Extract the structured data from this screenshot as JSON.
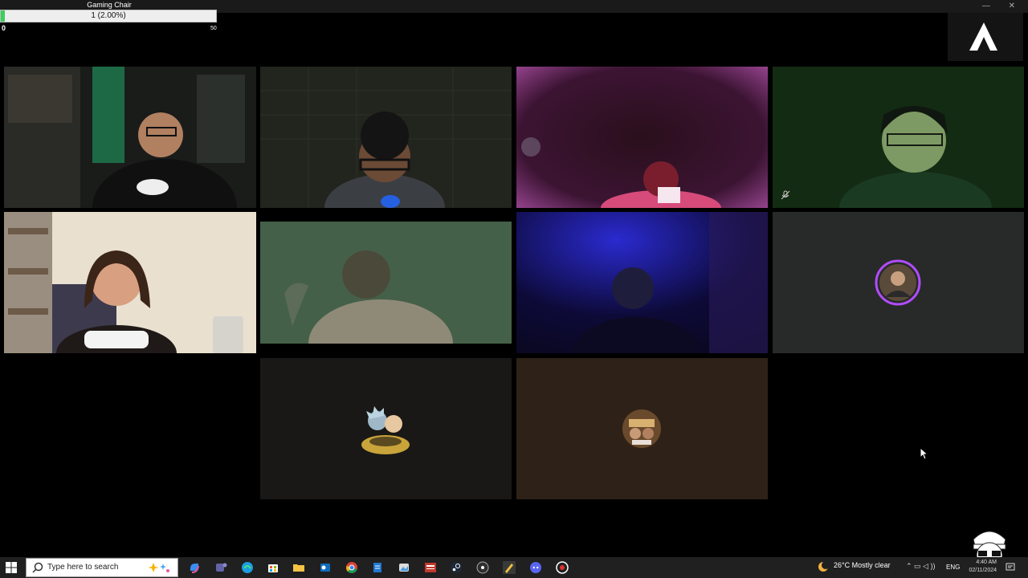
{
  "goal_widget": {
    "title": "Gaming Chair",
    "progress_text": "1 (2.00%)",
    "progress_fraction": 0.02,
    "min_label": "0",
    "max_label": "50"
  },
  "tiles": [
    {
      "name": "participant-1-video",
      "kind": "video",
      "scene": "streamer with cap in gaming room"
    },
    {
      "name": "participant-2-video",
      "kind": "video",
      "scene": "person with glasses, dark wall"
    },
    {
      "name": "participant-3-video",
      "kind": "video",
      "scene": "dark room with pink light"
    },
    {
      "name": "participant-4-video",
      "kind": "video",
      "scene": "person with glasses, green light",
      "muted": true
    },
    {
      "name": "participant-5-video",
      "kind": "video",
      "scene": "woman with microphone, bright room"
    },
    {
      "name": "participant-6-video",
      "kind": "video",
      "scene": "person in green-tinted room"
    },
    {
      "name": "participant-7-video",
      "kind": "video",
      "scene": "person in blue-lit room"
    },
    {
      "name": "participant-8-avatar",
      "kind": "avatar",
      "speaking": true
    },
    {
      "name": "participant-9-avatar",
      "kind": "avatar"
    },
    {
      "name": "participant-10-avatar",
      "kind": "avatar"
    }
  ],
  "colors": {
    "avatar_tile_dark": "#272a28",
    "avatar_tile_black": "#191816",
    "avatar_tile_brown": "#2e2118",
    "speaking_ring": "#b14cff",
    "goal_fill": "#3ccf5a"
  },
  "taskbar": {
    "search_placeholder": "Type here to search",
    "weather": "26°C  Mostly clear",
    "language": "ENG",
    "time": "4:40 AM",
    "date": "02/11/2024",
    "icons": [
      "start-icon",
      "copilot-icon",
      "teams-icon",
      "edge-icon",
      "store-icon",
      "file-explorer-icon",
      "outlook-icon",
      "chrome-icon",
      "notepad-icon",
      "photo-editor-icon",
      "news-icon",
      "steam-icon",
      "obs-icon",
      "pen-app-icon",
      "discord-icon",
      "browser-icon"
    ]
  }
}
